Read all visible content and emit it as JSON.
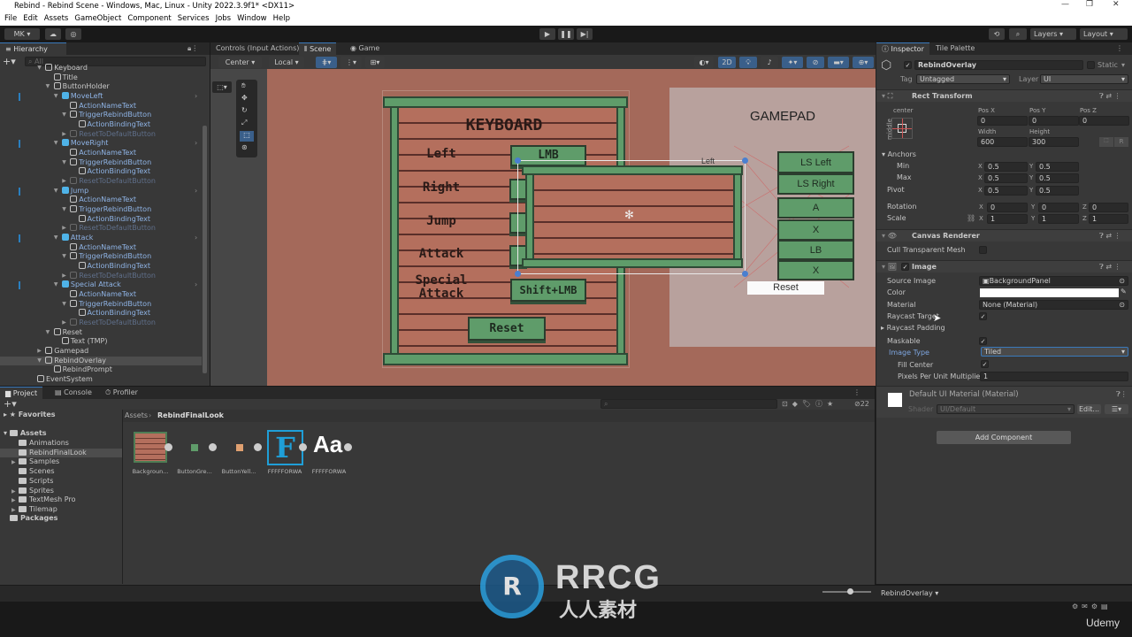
{
  "window": {
    "title": "Rebind - Rebind Scene - Windows, Mac, Linux - Unity 2022.3.9f1* <DX11>"
  },
  "menu": [
    "File",
    "Edit",
    "Assets",
    "GameObject",
    "Component",
    "Services",
    "Jobs",
    "Window",
    "Help"
  ],
  "toolbar": {
    "account": "MK ▾",
    "layers": "Layers",
    "layout": "Layout"
  },
  "hierarchy": {
    "tab": "Hierarchy",
    "search_placeholder": "All",
    "rows": [
      {
        "label": "Keyboard",
        "depth": 1,
        "expanded": true
      },
      {
        "label": "Title",
        "depth": 2
      },
      {
        "label": "ButtonHolder",
        "depth": 2,
        "expanded": true
      },
      {
        "label": "MoveLeft",
        "depth": 3,
        "expanded": true,
        "prefab": true
      },
      {
        "label": "ActionNameText",
        "depth": 4,
        "prefabChild": true
      },
      {
        "label": "TriggerRebindButton",
        "depth": 4,
        "expanded": true,
        "prefabChild": true
      },
      {
        "label": "ActionBindingText",
        "depth": 5,
        "prefabChild": true
      },
      {
        "label": "ResetToDefaultButton",
        "depth": 4,
        "collapsed": true,
        "inactive": true
      },
      {
        "label": "MoveRight",
        "depth": 3,
        "expanded": true,
        "prefab": true
      },
      {
        "label": "ActionNameText",
        "depth": 4,
        "prefabChild": true
      },
      {
        "label": "TriggerRebindButton",
        "depth": 4,
        "expanded": true,
        "prefabChild": true
      },
      {
        "label": "ActionBindingText",
        "depth": 5,
        "prefabChild": true
      },
      {
        "label": "ResetToDefaultButton",
        "depth": 4,
        "collapsed": true,
        "inactive": true
      },
      {
        "label": "Jump",
        "depth": 3,
        "expanded": true,
        "prefab": true
      },
      {
        "label": "ActionNameText",
        "depth": 4,
        "prefabChild": true
      },
      {
        "label": "TriggerRebindButton",
        "depth": 4,
        "expanded": true,
        "prefabChild": true
      },
      {
        "label": "ActionBindingText",
        "depth": 5,
        "prefabChild": true
      },
      {
        "label": "ResetToDefaultButton",
        "depth": 4,
        "collapsed": true,
        "inactive": true
      },
      {
        "label": "Attack",
        "depth": 3,
        "expanded": true,
        "prefab": true
      },
      {
        "label": "ActionNameText",
        "depth": 4,
        "prefabChild": true
      },
      {
        "label": "TriggerRebindButton",
        "depth": 4,
        "expanded": true,
        "prefabChild": true
      },
      {
        "label": "ActionBindingText",
        "depth": 5,
        "prefabChild": true
      },
      {
        "label": "ResetToDefaultButton",
        "depth": 4,
        "collapsed": true,
        "inactive": true
      },
      {
        "label": "Special Attack",
        "depth": 3,
        "expanded": true,
        "prefab": true
      },
      {
        "label": "ActionNameText",
        "depth": 4,
        "prefabChild": true
      },
      {
        "label": "TriggerRebindButton",
        "depth": 4,
        "expanded": true,
        "prefabChild": true
      },
      {
        "label": "ActionBindingText",
        "depth": 5,
        "prefabChild": true
      },
      {
        "label": "ResetToDefaultButton",
        "depth": 4,
        "collapsed": true,
        "inactive": true
      },
      {
        "label": "Reset",
        "depth": 2,
        "expanded": true
      },
      {
        "label": "Text (TMP)",
        "depth": 3
      },
      {
        "label": "Gamepad",
        "depth": 1,
        "collapsed": true
      },
      {
        "label": "RebindOverlay",
        "depth": 1,
        "expanded": true,
        "selected": true
      },
      {
        "label": "RebindPrompt",
        "depth": 2
      },
      {
        "label": "EventSystem",
        "depth": 0
      }
    ]
  },
  "scene_tabs": [
    "Controls (Input Actions)",
    "Scene",
    "Game"
  ],
  "scene_toolbar": {
    "pivot": "Center",
    "space": "Local",
    "mode_2d": "2D"
  },
  "scene": {
    "keyboard_title": "KEYBOARD",
    "actions": [
      "Left",
      "Right",
      "Jump",
      "Attack",
      "Special Attack"
    ],
    "bindings": {
      "left": "LMB",
      "special": "Shift+LMB"
    },
    "reset": "Reset",
    "overlay_label": "Left",
    "gamepad_title": "GAMEPAD",
    "gamepad_buttons": [
      "LS Left",
      "LS Right",
      "A",
      "X",
      "LB",
      "X"
    ],
    "gamepad_reset": "Reset"
  },
  "inspector": {
    "tabs": [
      "Inspector",
      "Tile Palette"
    ],
    "object_name": "RebindOverlay",
    "static_label": "Static",
    "tag_label": "Tag",
    "tag": "Untagged",
    "layer_label": "Layer",
    "layer": "UI",
    "rect_transform": {
      "title": "Rect Transform",
      "anchor_h": "center",
      "anchor_v": "middle",
      "pos_x_label": "Pos X",
      "pos_y_label": "Pos Y",
      "pos_z_label": "Pos Z",
      "pos_x": "0",
      "pos_y": "0",
      "pos_z": "0",
      "width_label": "Width",
      "height_label": "Height",
      "width": "600",
      "height": "300",
      "anchors_label": "Anchors",
      "min_label": "Min",
      "max_label": "Max",
      "pivot_label": "Pivot",
      "min_x": "0.5",
      "min_y": "0.5",
      "max_x": "0.5",
      "max_y": "0.5",
      "pivot_x": "0.5",
      "pivot_y": "0.5",
      "rotation_label": "Rotation",
      "scale_label": "Scale",
      "rot_x": "0",
      "rot_y": "0",
      "rot_z": "0",
      "scale_x": "1",
      "scale_y": "1",
      "scale_z": "1",
      "r_button": "R"
    },
    "canvas_renderer": {
      "title": "Canvas Renderer",
      "cull_label": "Cull Transparent Mesh",
      "cull": false
    },
    "image": {
      "title": "Image",
      "source_label": "Source Image",
      "source": "BackgroundPanel",
      "color_label": "Color",
      "color": "#ffffff",
      "material_label": "Material",
      "material": "None (Material)",
      "raycast_target_label": "Raycast Target",
      "raycast_target": true,
      "raycast_padding_label": "Raycast Padding",
      "maskable_label": "Maskable",
      "maskable": true,
      "image_type_label": "Image Type",
      "image_type": "Tiled",
      "fill_center_label": "Fill Center",
      "fill_center": true,
      "ppu_label": "Pixels Per Unit Multiplier",
      "ppu": "1"
    },
    "material": {
      "name": "Default UI Material (Material)",
      "shader_label": "Shader",
      "shader": "UI/Default",
      "edit": "Edit..."
    },
    "add_component": "Add Component"
  },
  "project": {
    "tabs": [
      "Project",
      "Console",
      "Profiler"
    ],
    "favorites": "Favorites",
    "assets": "Assets",
    "folders": [
      {
        "label": "Animations"
      },
      {
        "label": "RebindFinalLook",
        "selected": true
      },
      {
        "label": "Samples",
        "collapsed": true
      },
      {
        "label": "Scenes"
      },
      {
        "label": "Scripts"
      },
      {
        "label": "Sprites",
        "collapsed": true
      },
      {
        "label": "TextMesh Pro",
        "collapsed": true
      },
      {
        "label": "Tilemap",
        "collapsed": true
      }
    ],
    "packages": "Packages",
    "breadcrumb": [
      "Assets",
      "RebindFinalLook"
    ],
    "hidden_count": "22",
    "items": [
      "Backgroun...",
      "ButtonGre...",
      "ButtonYell...",
      "FFFFFORWA",
      "FFFFFORWA"
    ]
  },
  "status": {
    "selection": "RebindOverlay ▾",
    "udemy": "Udemy"
  },
  "watermark": {
    "logo": "RRCG",
    "sub": "人人素材"
  },
  "colors": {
    "accent": "#3a79bb",
    "prefab": "#4fb3e8",
    "scene_bg": "#a4695a",
    "button_green": "#5f9c6a"
  }
}
